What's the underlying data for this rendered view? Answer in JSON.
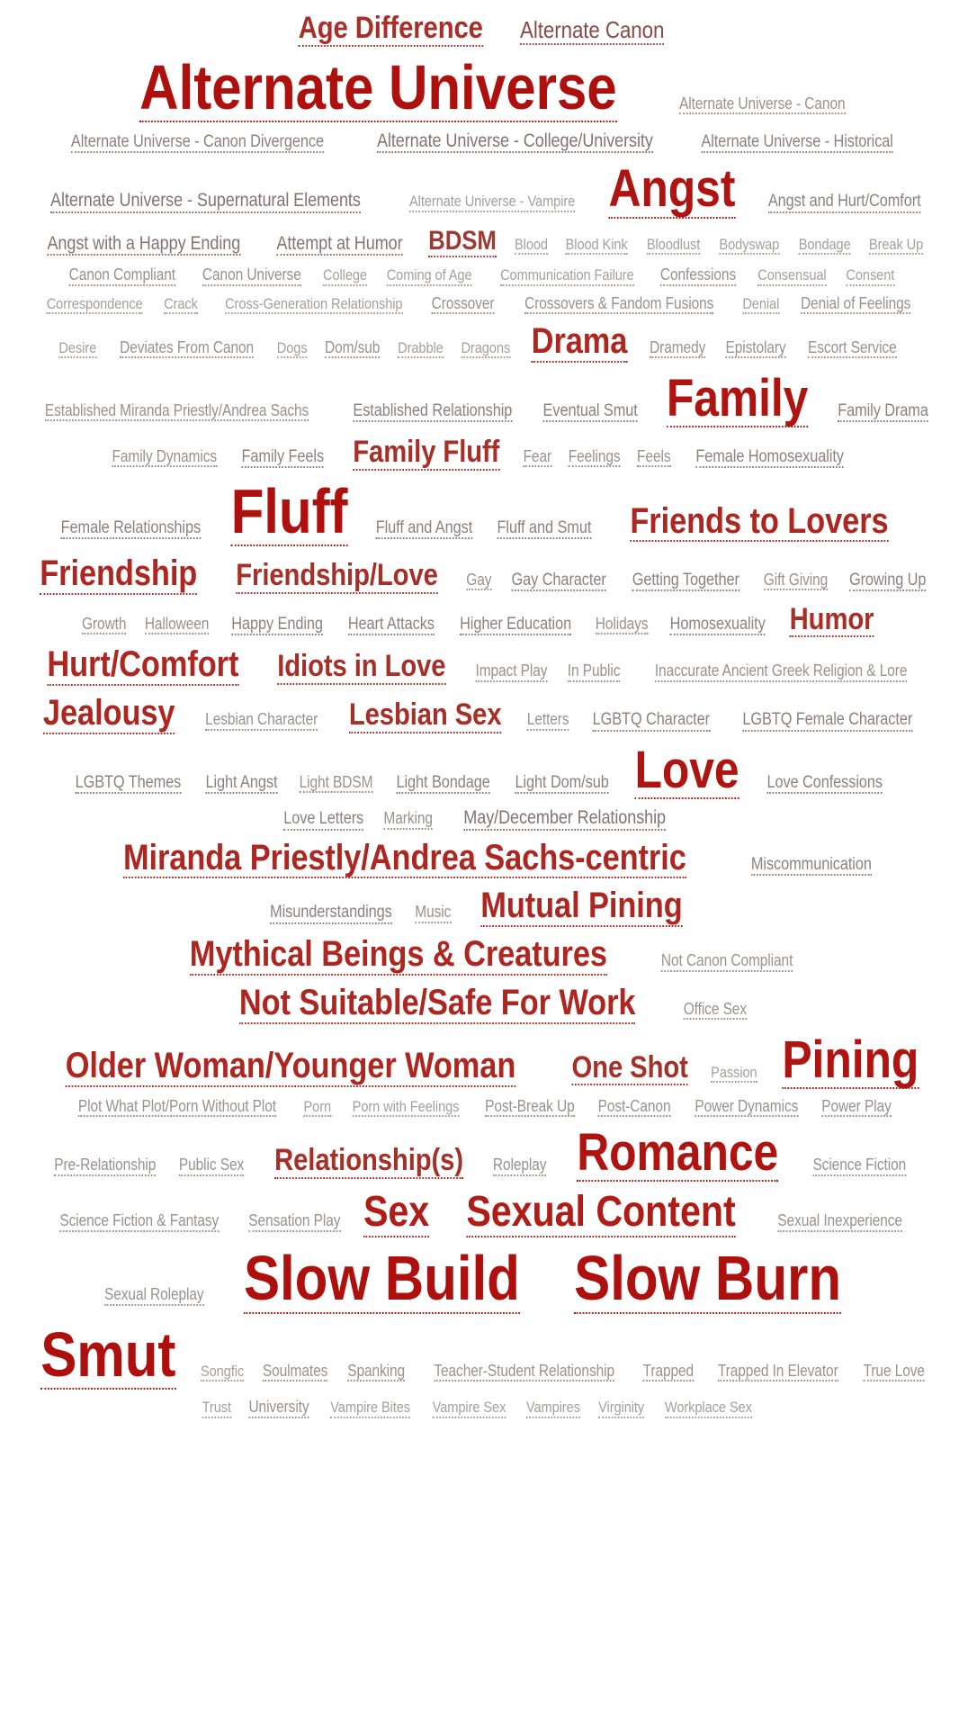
{
  "page": {
    "title": "Tag Cloud",
    "background_color": "#ffffff",
    "min_color": "#c9c6c6",
    "max_color": "#ae100e",
    "underline_style": "dotted"
  },
  "chart_data": {
    "type": "wordcloud",
    "title": "Fandom Tag Cloud",
    "xlabel": "",
    "ylabel": "",
    "layout": "alphabetical-flow",
    "size_encodes": "tag frequency",
    "color_encodes": "tag frequency",
    "color_scale": [
      "#c9c6c6",
      "#ae100e"
    ],
    "weight_levels": 15,
    "categories": [
      "Age Difference",
      "Alternate Canon",
      "Alternate Universe",
      "Alternate Universe - Canon",
      "Alternate Universe - Canon Divergence",
      "Alternate Universe - College/University",
      "Alternate Universe - Historical",
      "Alternate Universe - Supernatural Elements",
      "Alternate Universe - Vampire",
      "Angst",
      "Angst and Hurt/Comfort",
      "Angst with a Happy Ending",
      "Attempt at Humor",
      "BDSM",
      "Blood",
      "Blood Kink",
      "Bloodlust",
      "Bodyswap",
      "Bondage",
      "Break Up",
      "Canon Compliant",
      "Canon Universe",
      "College",
      "Coming of Age",
      "Communication Failure",
      "Confessions",
      "Consensual",
      "Consent",
      "Correspondence",
      "Crack",
      "Cross-Generation Relationship",
      "Crossover",
      "Crossovers & Fandom Fusions",
      "Denial",
      "Denial of Feelings",
      "Desire",
      "Deviates From Canon",
      "Dogs",
      "Dom/sub",
      "Drabble",
      "Dragons",
      "Drama",
      "Dramedy",
      "Epistolary",
      "Escort Service",
      "Established Miranda Priestly/Andrea Sachs",
      "Established Relationship",
      "Eventual Smut",
      "Family",
      "Family Drama",
      "Family Dynamics",
      "Family Feels",
      "Family Fluff",
      "Fear",
      "Feelings",
      "Feels",
      "Female Homosexuality",
      "Female Relationships",
      "Fluff",
      "Fluff and Angst",
      "Fluff and Smut",
      "Friends to Lovers",
      "Friendship",
      "Friendship/Love",
      "Gay",
      "Gay Character",
      "Getting Together",
      "Gift Giving",
      "Growing Up",
      "Growth",
      "Halloween",
      "Happy Ending",
      "Heart Attacks",
      "Higher Education",
      "Holidays",
      "Homosexuality",
      "Humor",
      "Hurt/Comfort",
      "Idiots in Love",
      "Impact Play",
      "In Public",
      "Inaccurate Ancient Greek Religion & Lore",
      "Jealousy",
      "Lesbian Character",
      "Lesbian Sex",
      "Letters",
      "LGBTQ Character",
      "LGBTQ Female Character",
      "LGBTQ Themes",
      "Light Angst",
      "Light BDSM",
      "Light Bondage",
      "Light Dom/sub",
      "Love",
      "Love Confessions",
      "Love Letters",
      "Marking",
      "May/December Relationship",
      "Miranda Priestly/Andrea Sachs-centric",
      "Miscommunication",
      "Misunderstandings",
      "Music",
      "Mutual Pining",
      "Mythical Beings & Creatures",
      "Not Canon Compliant",
      "Not Suitable/Safe For Work",
      "Office Sex",
      "Older Woman/Younger Woman",
      "One Shot",
      "Passion",
      "Pining",
      "Plot What Plot/Porn Without Plot",
      "Porn",
      "Porn with Feelings",
      "Post-Break Up",
      "Post-Canon",
      "Power Dynamics",
      "Power Play",
      "Pre-Relationship",
      "Public Sex",
      "Relationship(s)",
      "Roleplay",
      "Romance",
      "Science Fiction",
      "Science Fiction & Fantasy",
      "Sensation Play",
      "Sex",
      "Sexual Content",
      "Sexual Inexperience",
      "Sexual Roleplay",
      "Slow Build",
      "Slow Burn",
      "Smut",
      "Songfic",
      "Soulmates",
      "Spanking",
      "Teacher-Student Relationship",
      "Trapped",
      "Trapped In Elevator",
      "True Love",
      "Trust",
      "University",
      "Vampire Bites",
      "Vampire Sex",
      "Vampires",
      "Virginity",
      "Workplace Sex"
    ],
    "values": [
      11,
      9,
      15,
      5,
      6,
      7,
      6,
      7,
      4,
      14,
      6,
      7,
      7,
      10,
      4,
      4,
      4,
      4,
      4,
      4,
      5,
      5,
      4,
      4,
      4,
      5,
      4,
      4,
      4,
      4,
      4,
      5,
      5,
      4,
      5,
      4,
      5,
      4,
      5,
      4,
      4,
      12,
      5,
      5,
      5,
      5,
      6,
      6,
      14,
      6,
      5,
      6,
      11,
      5,
      5,
      5,
      6,
      6,
      15,
      6,
      6,
      12,
      12,
      11,
      5,
      6,
      6,
      5,
      6,
      5,
      5,
      6,
      6,
      6,
      5,
      6,
      11,
      12,
      11,
      5,
      5,
      5,
      12,
      5,
      11,
      5,
      6,
      6,
      6,
      6,
      5,
      6,
      6,
      14,
      6,
      6,
      5,
      7,
      12,
      6,
      6,
      5,
      12,
      12,
      5,
      12,
      5,
      12,
      11,
      4,
      14,
      5,
      4,
      4,
      5,
      5,
      5,
      5,
      5,
      5,
      11,
      5,
      14,
      5,
      5,
      5,
      13,
      13,
      5,
      5,
      15,
      15,
      15,
      4,
      5,
      5,
      5,
      5,
      5,
      5,
      4,
      5,
      4,
      4,
      4,
      4,
      4
    ]
  },
  "tags": [
    {
      "label": "Age Difference",
      "weight": 11
    },
    {
      "label": "Alternate Canon",
      "weight": 9
    },
    {
      "label": "Alternate Universe",
      "weight": 15
    },
    {
      "label": "Alternate Universe - Canon",
      "weight": 5
    },
    {
      "label": "Alternate Universe - Canon Divergence",
      "weight": 6
    },
    {
      "label": "Alternate Universe - College/University",
      "weight": 7
    },
    {
      "label": "Alternate Universe - Historical",
      "weight": 6
    },
    {
      "label": "Alternate Universe - Supernatural Elements",
      "weight": 7
    },
    {
      "label": "Alternate Universe - Vampire",
      "weight": 4
    },
    {
      "label": "Angst",
      "weight": 14
    },
    {
      "label": "Angst and Hurt/Comfort",
      "weight": 6
    },
    {
      "label": "Angst with a Happy Ending",
      "weight": 7
    },
    {
      "label": "Attempt at Humor",
      "weight": 7
    },
    {
      "label": "BDSM",
      "weight": 10
    },
    {
      "label": "Blood",
      "weight": 4
    },
    {
      "label": "Blood Kink",
      "weight": 4
    },
    {
      "label": "Bloodlust",
      "weight": 4
    },
    {
      "label": "Bodyswap",
      "weight": 4
    },
    {
      "label": "Bondage",
      "weight": 4
    },
    {
      "label": "Break Up",
      "weight": 4
    },
    {
      "label": "Canon Compliant",
      "weight": 5
    },
    {
      "label": "Canon Universe",
      "weight": 5
    },
    {
      "label": "College",
      "weight": 4
    },
    {
      "label": "Coming of Age",
      "weight": 4
    },
    {
      "label": "Communication Failure",
      "weight": 4
    },
    {
      "label": "Confessions",
      "weight": 5
    },
    {
      "label": "Consensual",
      "weight": 4
    },
    {
      "label": "Consent",
      "weight": 4
    },
    {
      "label": "Correspondence",
      "weight": 4
    },
    {
      "label": "Crack",
      "weight": 4
    },
    {
      "label": "Cross-Generation Relationship",
      "weight": 4
    },
    {
      "label": "Crossover",
      "weight": 5
    },
    {
      "label": "Crossovers & Fandom Fusions",
      "weight": 5
    },
    {
      "label": "Denial",
      "weight": 4
    },
    {
      "label": "Denial of Feelings",
      "weight": 5
    },
    {
      "label": "Desire",
      "weight": 4
    },
    {
      "label": "Deviates From Canon",
      "weight": 5
    },
    {
      "label": "Dogs",
      "weight": 4
    },
    {
      "label": "Dom/sub",
      "weight": 5
    },
    {
      "label": "Drabble",
      "weight": 4
    },
    {
      "label": "Dragons",
      "weight": 4
    },
    {
      "label": "Drama",
      "weight": 12
    },
    {
      "label": "Dramedy",
      "weight": 5
    },
    {
      "label": "Epistolary",
      "weight": 5
    },
    {
      "label": "Escort Service",
      "weight": 5
    },
    {
      "label": "Established Miranda Priestly/Andrea Sachs",
      "weight": 5
    },
    {
      "label": "Established Relationship",
      "weight": 6
    },
    {
      "label": "Eventual Smut",
      "weight": 6
    },
    {
      "label": "Family",
      "weight": 14
    },
    {
      "label": "Family Drama",
      "weight": 6
    },
    {
      "label": "Family Dynamics",
      "weight": 5
    },
    {
      "label": "Family Feels",
      "weight": 6
    },
    {
      "label": "Family Fluff",
      "weight": 11
    },
    {
      "label": "Fear",
      "weight": 5
    },
    {
      "label": "Feelings",
      "weight": 5
    },
    {
      "label": "Feels",
      "weight": 5
    },
    {
      "label": "Female Homosexuality",
      "weight": 6
    },
    {
      "label": "Female Relationships",
      "weight": 6
    },
    {
      "label": "Fluff",
      "weight": 15
    },
    {
      "label": "Fluff and Angst",
      "weight": 6
    },
    {
      "label": "Fluff and Smut",
      "weight": 6
    },
    {
      "label": "Friends to Lovers",
      "weight": 12
    },
    {
      "label": "Friendship",
      "weight": 12
    },
    {
      "label": "Friendship/Love",
      "weight": 11
    },
    {
      "label": "Gay",
      "weight": 5
    },
    {
      "label": "Gay Character",
      "weight": 6
    },
    {
      "label": "Getting Together",
      "weight": 6
    },
    {
      "label": "Gift Giving",
      "weight": 5
    },
    {
      "label": "Growing Up",
      "weight": 6
    },
    {
      "label": "Growth",
      "weight": 5
    },
    {
      "label": "Halloween",
      "weight": 5
    },
    {
      "label": "Happy Ending",
      "weight": 6
    },
    {
      "label": "Heart Attacks",
      "weight": 6
    },
    {
      "label": "Higher Education",
      "weight": 6
    },
    {
      "label": "Holidays",
      "weight": 5
    },
    {
      "label": "Homosexuality",
      "weight": 6
    },
    {
      "label": "Humor",
      "weight": 11
    },
    {
      "label": "Hurt/Comfort",
      "weight": 12
    },
    {
      "label": "Idiots in Love",
      "weight": 11
    },
    {
      "label": "Impact Play",
      "weight": 5
    },
    {
      "label": "In Public",
      "weight": 5
    },
    {
      "label": "Inaccurate Ancient Greek Religion & Lore",
      "weight": 5
    },
    {
      "label": "Jealousy",
      "weight": 12
    },
    {
      "label": "Lesbian Character",
      "weight": 5
    },
    {
      "label": "Lesbian Sex",
      "weight": 11
    },
    {
      "label": "Letters",
      "weight": 5
    },
    {
      "label": "LGBTQ Character",
      "weight": 6
    },
    {
      "label": "LGBTQ Female Character",
      "weight": 6
    },
    {
      "label": "LGBTQ Themes",
      "weight": 6
    },
    {
      "label": "Light Angst",
      "weight": 6
    },
    {
      "label": "Light BDSM",
      "weight": 5
    },
    {
      "label": "Light Bondage",
      "weight": 6
    },
    {
      "label": "Light Dom/sub",
      "weight": 6
    },
    {
      "label": "Love",
      "weight": 14
    },
    {
      "label": "Love Confessions",
      "weight": 6
    },
    {
      "label": "Love Letters",
      "weight": 6
    },
    {
      "label": "Marking",
      "weight": 5
    },
    {
      "label": "May/December Relationship",
      "weight": 7
    },
    {
      "label": "Miranda Priestly/Andrea Sachs-centric",
      "weight": 12
    },
    {
      "label": "Miscommunication",
      "weight": 6
    },
    {
      "label": "Misunderstandings",
      "weight": 6
    },
    {
      "label": "Music",
      "weight": 5
    },
    {
      "label": "Mutual Pining",
      "weight": 12
    },
    {
      "label": "Mythical Beings & Creatures",
      "weight": 12
    },
    {
      "label": "Not Canon Compliant",
      "weight": 5
    },
    {
      "label": "Not Suitable/Safe For Work",
      "weight": 12
    },
    {
      "label": "Office Sex",
      "weight": 5
    },
    {
      "label": "Older Woman/Younger Woman",
      "weight": 12
    },
    {
      "label": "One Shot",
      "weight": 11
    },
    {
      "label": "Passion",
      "weight": 4
    },
    {
      "label": "Pining",
      "weight": 14
    },
    {
      "label": "Plot What Plot/Porn Without Plot",
      "weight": 5
    },
    {
      "label": "Porn",
      "weight": 4
    },
    {
      "label": "Porn with Feelings",
      "weight": 4
    },
    {
      "label": "Post-Break Up",
      "weight": 5
    },
    {
      "label": "Post-Canon",
      "weight": 5
    },
    {
      "label": "Power Dynamics",
      "weight": 5
    },
    {
      "label": "Power Play",
      "weight": 5
    },
    {
      "label": "Pre-Relationship",
      "weight": 5
    },
    {
      "label": "Public Sex",
      "weight": 5
    },
    {
      "label": "Relationship(s)",
      "weight": 11
    },
    {
      "label": "Roleplay",
      "weight": 5
    },
    {
      "label": "Romance",
      "weight": 14
    },
    {
      "label": "Science Fiction",
      "weight": 5
    },
    {
      "label": "Science Fiction & Fantasy",
      "weight": 5
    },
    {
      "label": "Sensation Play",
      "weight": 5
    },
    {
      "label": "Sex",
      "weight": 13
    },
    {
      "label": "Sexual Content",
      "weight": 13
    },
    {
      "label": "Sexual Inexperience",
      "weight": 5
    },
    {
      "label": "Sexual Roleplay",
      "weight": 5
    },
    {
      "label": "Slow Build",
      "weight": 15
    },
    {
      "label": "Slow Burn",
      "weight": 15
    },
    {
      "label": "Smut",
      "weight": 15
    },
    {
      "label": "Songfic",
      "weight": 4
    },
    {
      "label": "Soulmates",
      "weight": 5
    },
    {
      "label": "Spanking",
      "weight": 5
    },
    {
      "label": "Teacher-Student Relationship",
      "weight": 5
    },
    {
      "label": "Trapped",
      "weight": 5
    },
    {
      "label": "Trapped In Elevator",
      "weight": 5
    },
    {
      "label": "True Love",
      "weight": 5
    },
    {
      "label": "Trust",
      "weight": 4
    },
    {
      "label": "University",
      "weight": 5
    },
    {
      "label": "Vampire Bites",
      "weight": 4
    },
    {
      "label": "Vampire Sex",
      "weight": 4
    },
    {
      "label": "Vampires",
      "weight": 4
    },
    {
      "label": "Virginity",
      "weight": 4
    },
    {
      "label": "Workplace Sex",
      "weight": 4
    }
  ]
}
